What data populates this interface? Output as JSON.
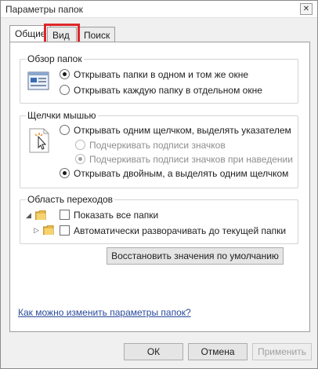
{
  "window": {
    "title": "Параметры папок",
    "close_glyph": "✕"
  },
  "tabs": [
    {
      "label": "Общие",
      "active": true
    },
    {
      "label": "Вид",
      "active": false,
      "highlighted": true
    },
    {
      "label": "Поиск",
      "active": false
    }
  ],
  "browse_folders": {
    "title": "Обзор папок",
    "options": [
      {
        "label": "Открывать папки в одном и том же окне",
        "checked": true
      },
      {
        "label": "Открывать каждую папку в отдельном окне",
        "checked": false
      }
    ]
  },
  "mouse_clicks": {
    "title": "Щелчки мышью",
    "options": [
      {
        "label": "Открывать одним щелчком, выделять указателем",
        "checked": false,
        "enabled": true
      },
      {
        "label": "Подчеркивать подписи значков",
        "checked": false,
        "enabled": false
      },
      {
        "label": "Подчеркивать подписи значков при наведении",
        "checked": true,
        "enabled": false
      },
      {
        "label": "Открывать двойным, а выделять одним щелчком",
        "checked": true,
        "enabled": true
      }
    ]
  },
  "navigation_pane": {
    "title": "Область переходов",
    "options": [
      {
        "label": "Показать все папки",
        "checked": false,
        "icon": "folder-expanded-icon"
      },
      {
        "label": "Автоматически разворачивать до текущей папки",
        "checked": false,
        "icon": "folder-collapsed-icon"
      }
    ]
  },
  "restore_button_label": "Восстановить значения по умолчанию",
  "help_link": "Как можно изменить параметры папок?",
  "footer": {
    "ok": "ОК",
    "cancel": "Отмена",
    "apply": "Применить"
  },
  "colors": {
    "highlight": "#e0262a",
    "link": "#2a4a9a"
  }
}
